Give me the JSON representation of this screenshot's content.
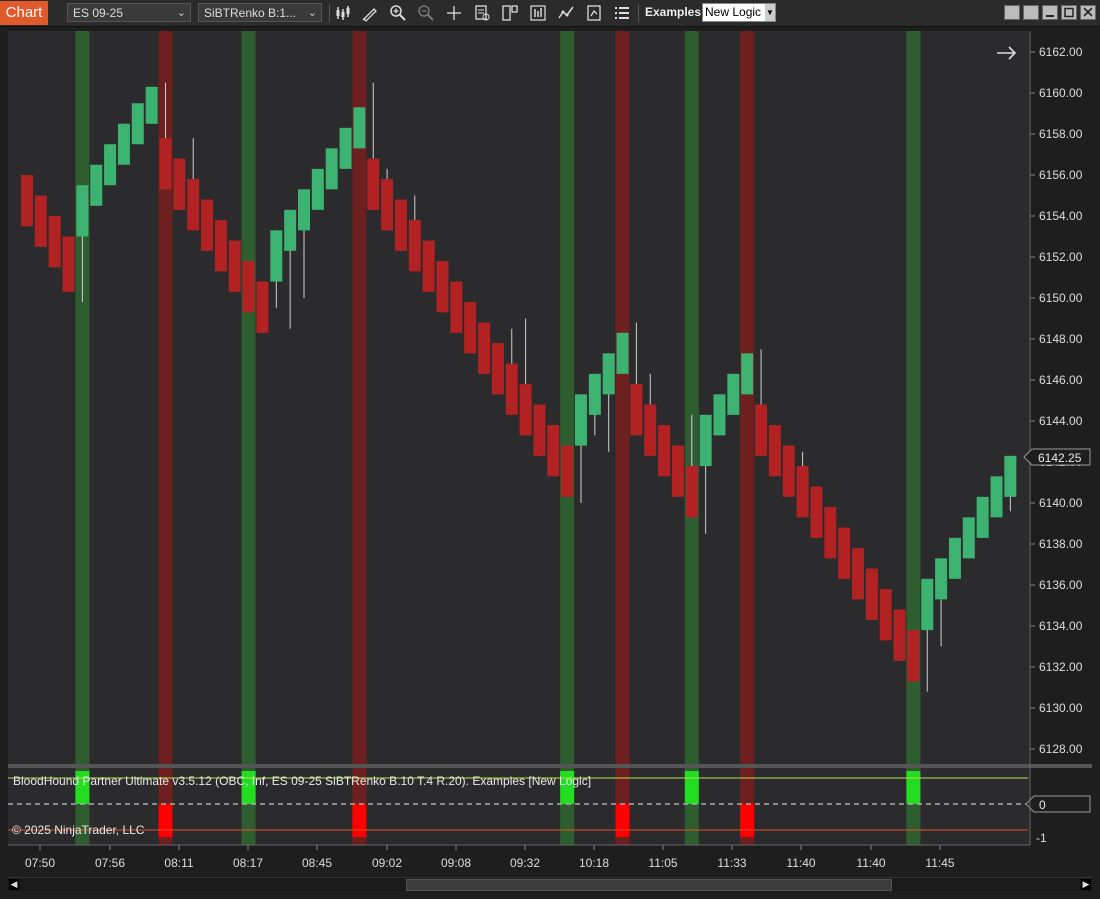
{
  "toolbar": {
    "chart_tab": "Chart",
    "instrument": "ES 09-25",
    "bar_type": "SiBTRenko B:1...",
    "strategy_label": "Examples",
    "strategy_value": "New Logic"
  },
  "colors": {
    "up": "#3cb371",
    "down": "#b22222",
    "up_stripe": "#2e5e30",
    "down_stripe": "#6e2020",
    "signal_up": "#22dd22",
    "signal_down": "#ff0000",
    "price_bg": "#2b2b2e",
    "upper_line": "#b0e050",
    "lower_line": "#e05020"
  },
  "chart_data": {
    "type": "candlestick",
    "ylim": [
      6127,
      6163
    ],
    "y_ticks": [
      "6162.00",
      "6160.00",
      "6158.00",
      "6156.00",
      "6154.00",
      "6152.00",
      "6150.00",
      "6148.00",
      "6146.00",
      "6144.00",
      "6142.00",
      "6140.00",
      "6138.00",
      "6136.00",
      "6134.00",
      "6132.00",
      "6130.00",
      "6128.00"
    ],
    "x_labels": [
      "07:50",
      "07:56",
      "08:11",
      "08:17",
      "08:45",
      "09:02",
      "09:08",
      "09:32",
      "10:18",
      "11:05",
      "11:33",
      "11:40",
      "11:40",
      "11:45"
    ],
    "last_price": "6142.25",
    "candles": [
      {
        "o": 6156,
        "c": 6153.5,
        "h": 6156,
        "l": 6153.5
      },
      {
        "o": 6155,
        "c": 6152.5,
        "h": 6155,
        "l": 6152.5
      },
      {
        "o": 6154,
        "c": 6151.5,
        "h": 6154,
        "l": 6151.5
      },
      {
        "o": 6153,
        "c": 6150.3,
        "h": 6153,
        "l": 6150.3
      },
      {
        "o": 6153,
        "c": 6155.5,
        "h": 6155.5,
        "l": 6149.8
      },
      {
        "o": 6154.5,
        "c": 6156.5,
        "h": 6156.5,
        "l": 6154.5
      },
      {
        "o": 6155.5,
        "c": 6157.5,
        "h": 6157.5,
        "l": 6155.5
      },
      {
        "o": 6156.5,
        "c": 6158.5,
        "h": 6158.5,
        "l": 6156.5
      },
      {
        "o": 6157.5,
        "c": 6159.5,
        "h": 6159.5,
        "l": 6157.5
      },
      {
        "o": 6158.5,
        "c": 6160.3,
        "h": 6160.3,
        "l": 6158.5
      },
      {
        "o": 6157.8,
        "c": 6155.3,
        "h": 6160.5,
        "l": 6155.3
      },
      {
        "o": 6156.8,
        "c": 6154.3,
        "h": 6156.8,
        "l": 6154.3
      },
      {
        "o": 6155.8,
        "c": 6153.3,
        "h": 6157.8,
        "l": 6153.3
      },
      {
        "o": 6154.8,
        "c": 6152.3,
        "h": 6154.8,
        "l": 6152.3
      },
      {
        "o": 6153.8,
        "c": 6151.3,
        "h": 6153,
        "l": 6151.3
      },
      {
        "o": 6152.8,
        "c": 6150.3,
        "h": 6152.8,
        "l": 6150.3
      },
      {
        "o": 6151.8,
        "c": 6149.3,
        "h": 6151.8,
        "l": 6149.3
      },
      {
        "o": 6150.8,
        "c": 6148.3,
        "h": 6150.8,
        "l": 6148.3
      },
      {
        "o": 6150.8,
        "c": 6153.3,
        "h": 6153.3,
        "l": 6149.5
      },
      {
        "o": 6152.3,
        "c": 6154.3,
        "h": 6154.3,
        "l": 6148.5
      },
      {
        "o": 6153.3,
        "c": 6155.3,
        "h": 6155.3,
        "l": 6150
      },
      {
        "o": 6154.3,
        "c": 6156.3,
        "h": 6156.3,
        "l": 6154.3
      },
      {
        "o": 6155.3,
        "c": 6157.3,
        "h": 6157.3,
        "l": 6155.3
      },
      {
        "o": 6156.3,
        "c": 6158.3,
        "h": 6158.3,
        "l": 6156.3
      },
      {
        "o": 6157.3,
        "c": 6159.3,
        "h": 6159.3,
        "l": 6157.3
      },
      {
        "o": 6156.8,
        "c": 6154.3,
        "h": 6160.5,
        "l": 6154.3
      },
      {
        "o": 6155.8,
        "c": 6153.3,
        "h": 6156.3,
        "l": 6153.3
      },
      {
        "o": 6154.8,
        "c": 6152.3,
        "h": 6154.8,
        "l": 6152.3
      },
      {
        "o": 6153.8,
        "c": 6151.3,
        "h": 6155,
        "l": 6151.3
      },
      {
        "o": 6152.8,
        "c": 6150.3,
        "h": 6152.8,
        "l": 6150.3
      },
      {
        "o": 6151.8,
        "c": 6149.3,
        "h": 6151.8,
        "l": 6149.3
      },
      {
        "o": 6150.8,
        "c": 6148.3,
        "h": 6150.8,
        "l": 6148.3
      },
      {
        "o": 6149.8,
        "c": 6147.3,
        "h": 6149.8,
        "l": 6147.3
      },
      {
        "o": 6148.8,
        "c": 6146.3,
        "h": 6148.8,
        "l": 6146.3
      },
      {
        "o": 6147.8,
        "c": 6145.3,
        "h": 6147.8,
        "l": 6145.3
      },
      {
        "o": 6146.8,
        "c": 6144.3,
        "h": 6148.5,
        "l": 6144.3
      },
      {
        "o": 6145.8,
        "c": 6143.3,
        "h": 6149,
        "l": 6143.3
      },
      {
        "o": 6144.8,
        "c": 6142.3,
        "h": 6144.8,
        "l": 6142.3
      },
      {
        "o": 6143.8,
        "c": 6141.3,
        "h": 6143.8,
        "l": 6141.3
      },
      {
        "o": 6142.8,
        "c": 6140.3,
        "h": 6142.8,
        "l": 6140.3
      },
      {
        "o": 6142.8,
        "c": 6145.3,
        "h": 6145.3,
        "l": 6140
      },
      {
        "o": 6144.3,
        "c": 6146.3,
        "h": 6146.3,
        "l": 6143.3
      },
      {
        "o": 6145.3,
        "c": 6147.3,
        "h": 6147.3,
        "l": 6142.5
      },
      {
        "o": 6146.3,
        "c": 6148.3,
        "h": 6148.3,
        "l": 6146.3
      },
      {
        "o": 6145.8,
        "c": 6143.3,
        "h": 6148.8,
        "l": 6143.3
      },
      {
        "o": 6144.8,
        "c": 6142.3,
        "h": 6146.3,
        "l": 6142.3
      },
      {
        "o": 6143.8,
        "c": 6141.3,
        "h": 6143.8,
        "l": 6141.3
      },
      {
        "o": 6142.8,
        "c": 6140.3,
        "h": 6142.8,
        "l": 6140.3
      },
      {
        "o": 6141.8,
        "c": 6139.3,
        "h": 6144.3,
        "l": 6139.3
      },
      {
        "o": 6141.8,
        "c": 6144.3,
        "h": 6144.3,
        "l": 6138.5
      },
      {
        "o": 6143.3,
        "c": 6145.3,
        "h": 6145.3,
        "l": 6143.3
      },
      {
        "o": 6144.3,
        "c": 6146.3,
        "h": 6146.3,
        "l": 6144.3
      },
      {
        "o": 6145.3,
        "c": 6147.3,
        "h": 6147.3,
        "l": 6145.3
      },
      {
        "o": 6144.8,
        "c": 6142.3,
        "h": 6147.5,
        "l": 6142.3
      },
      {
        "o": 6143.8,
        "c": 6141.3,
        "h": 6143.8,
        "l": 6141.3
      },
      {
        "o": 6142.8,
        "c": 6140.3,
        "h": 6142.8,
        "l": 6140.3
      },
      {
        "o": 6141.8,
        "c": 6139.3,
        "h": 6142.5,
        "l": 6139.3
      },
      {
        "o": 6140.8,
        "c": 6138.3,
        "h": 6140.8,
        "l": 6138.3
      },
      {
        "o": 6139.8,
        "c": 6137.3,
        "h": 6139.8,
        "l": 6137.3
      },
      {
        "o": 6138.8,
        "c": 6136.3,
        "h": 6138.8,
        "l": 6136.3
      },
      {
        "o": 6137.8,
        "c": 6135.3,
        "h": 6137.8,
        "l": 6135.3
      },
      {
        "o": 6136.8,
        "c": 6134.3,
        "h": 6136.8,
        "l": 6134.3
      },
      {
        "o": 6135.8,
        "c": 6133.3,
        "h": 6135.8,
        "l": 6133.3
      },
      {
        "o": 6134.8,
        "c": 6132.3,
        "h": 6134.8,
        "l": 6132.3
      },
      {
        "o": 6133.8,
        "c": 6131.3,
        "h": 6133.8,
        "l": 6131.3
      },
      {
        "o": 6133.8,
        "c": 6136.3,
        "h": 6136.3,
        "l": 6130.8
      },
      {
        "o": 6135.3,
        "c": 6137.3,
        "h": 6137.3,
        "l": 6133
      },
      {
        "o": 6136.3,
        "c": 6138.3,
        "h": 6138.3,
        "l": 6136.3
      },
      {
        "o": 6137.3,
        "c": 6139.3,
        "h": 6139.3,
        "l": 6137.3
      },
      {
        "o": 6138.3,
        "c": 6140.3,
        "h": 6140.3,
        "l": 6138.3
      },
      {
        "o": 6139.3,
        "c": 6141.3,
        "h": 6141.3,
        "l": 6139.3
      },
      {
        "o": 6140.3,
        "c": 6142.3,
        "h": 6142.3,
        "l": 6139.6
      }
    ],
    "signal_stripes": [
      {
        "bar": 4,
        "dir": "up"
      },
      {
        "bar": 10,
        "dir": "down"
      },
      {
        "bar": 16,
        "dir": "up"
      },
      {
        "bar": 24,
        "dir": "down"
      },
      {
        "bar": 39,
        "dir": "up"
      },
      {
        "bar": 43,
        "dir": "down"
      },
      {
        "bar": 48,
        "dir": "up"
      },
      {
        "bar": 52,
        "dir": "down"
      },
      {
        "bar": 64,
        "dir": "up"
      }
    ]
  },
  "indicator": {
    "title": "BloodHound Partner Ultimate v3.5.12 (OBC, Inf, ES 09-25 SiBTRenko B.10 T.4 R.20). Examples  [New Logic]",
    "copyright": "© 2025 NinjaTrader, LLC",
    "axis_labels": [
      "0",
      "-1"
    ],
    "ylim": [
      -1.4,
      1.4
    ]
  }
}
